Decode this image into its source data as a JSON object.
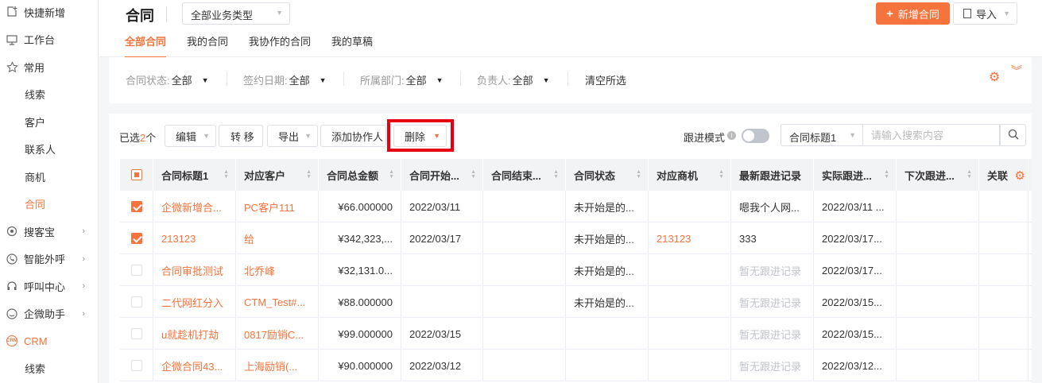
{
  "sidebar": {
    "items": [
      {
        "label": "快捷新增",
        "icon": "plus-square-icon"
      },
      {
        "label": "工作台",
        "icon": "monitor-icon"
      },
      {
        "label": "常用",
        "icon": "star-icon"
      },
      {
        "label": "线索"
      },
      {
        "label": "客户"
      },
      {
        "label": "联系人"
      },
      {
        "label": "商机"
      },
      {
        "label": "合同"
      },
      {
        "label": "搜客宝",
        "icon": "search-radar-icon"
      },
      {
        "label": "智能外呼",
        "icon": "phone-icon"
      },
      {
        "label": "呼叫中心",
        "icon": "headset-icon"
      },
      {
        "label": "企微助手",
        "icon": "wecom-icon"
      },
      {
        "label": "CRM",
        "icon": "crm-icon"
      },
      {
        "label": "线索"
      }
    ],
    "crm_logo_text": "CRM"
  },
  "header": {
    "title": "合同",
    "type_select": "全部业务类型",
    "tabs": [
      "全部合同",
      "我的合同",
      "我协作的合同",
      "我的草稿"
    ],
    "new_button": "新增合同",
    "import_button": "导入"
  },
  "filters": {
    "status_label": "合同状态:",
    "status_value": "全部",
    "date_label": "签约日期:",
    "date_value": "全部",
    "dept_label": "所属部门:",
    "dept_value": "全部",
    "owner_label": "负责人:",
    "owner_value": "全部",
    "clear": "清空所选"
  },
  "toolbar": {
    "selected_prefix": "已选",
    "selected_count": "2",
    "selected_suffix": "个",
    "edit": "编辑",
    "transfer": "转 移",
    "export": "导出",
    "add_collaborator": "添加协作人",
    "delete": "删除",
    "follow_mode": "跟进模式",
    "search_field": "合同标题1",
    "search_placeholder": "请输入搜索内容"
  },
  "table": {
    "columns": [
      "合同标题1",
      "对应客户",
      "合同总金额",
      "合同开始...",
      "合同结束...",
      "合同状态",
      "对应商机",
      "最新跟进记录",
      "实际跟进...",
      "下次跟进...",
      "关联"
    ],
    "rows": [
      {
        "checked": true,
        "title": "企微新增合...",
        "customer": "PC客户111",
        "amount": "¥66.000000",
        "start": "2022/03/11",
        "end": "",
        "status": "未开始是的...",
        "opportunity": "",
        "latest": "嗯我个人网...",
        "actual": "2022/03/11 ...",
        "next": ""
      },
      {
        "checked": true,
        "title": "213123",
        "customer": "给",
        "amount": "¥342,323,...",
        "start": "2022/03/17",
        "end": "",
        "status": "未开始是的...",
        "opportunity": "213123",
        "latest": "333",
        "actual": "2022/03/17...",
        "next": ""
      },
      {
        "checked": false,
        "title": "合同审批测试",
        "customer": "北乔峰",
        "amount": "¥32,131.0...",
        "start": "",
        "end": "",
        "status": "未开始是的...",
        "opportunity": "",
        "latest": "暂无跟进记录",
        "actual": "2022/03/17...",
        "next": ""
      },
      {
        "checked": false,
        "title": "二代网红分入",
        "customer": "CTM_Test#...",
        "amount": "¥88.000000",
        "start": "",
        "end": "",
        "status": "未开始是的...",
        "opportunity": "",
        "latest": "暂无跟进记录",
        "actual": "2022/03/15...",
        "next": ""
      },
      {
        "checked": false,
        "title": "u就趁机打劫",
        "customer": "0817励销C...",
        "amount": "¥99.000000",
        "start": "2022/03/15",
        "end": "",
        "status": "",
        "opportunity": "",
        "latest": "暂无跟进记录",
        "actual": "2022/03/15...",
        "next": ""
      },
      {
        "checked": false,
        "title": "企微合同43...",
        "customer": "上海励销(...",
        "amount": "¥90.000000",
        "start": "2022/03/12",
        "end": "",
        "status": "",
        "opportunity": "",
        "latest": "暂无跟进记录",
        "actual": "2022/03/12...",
        "next": ""
      }
    ]
  },
  "colors": {
    "accent": "#f5733c",
    "highlight": "#e60012"
  }
}
